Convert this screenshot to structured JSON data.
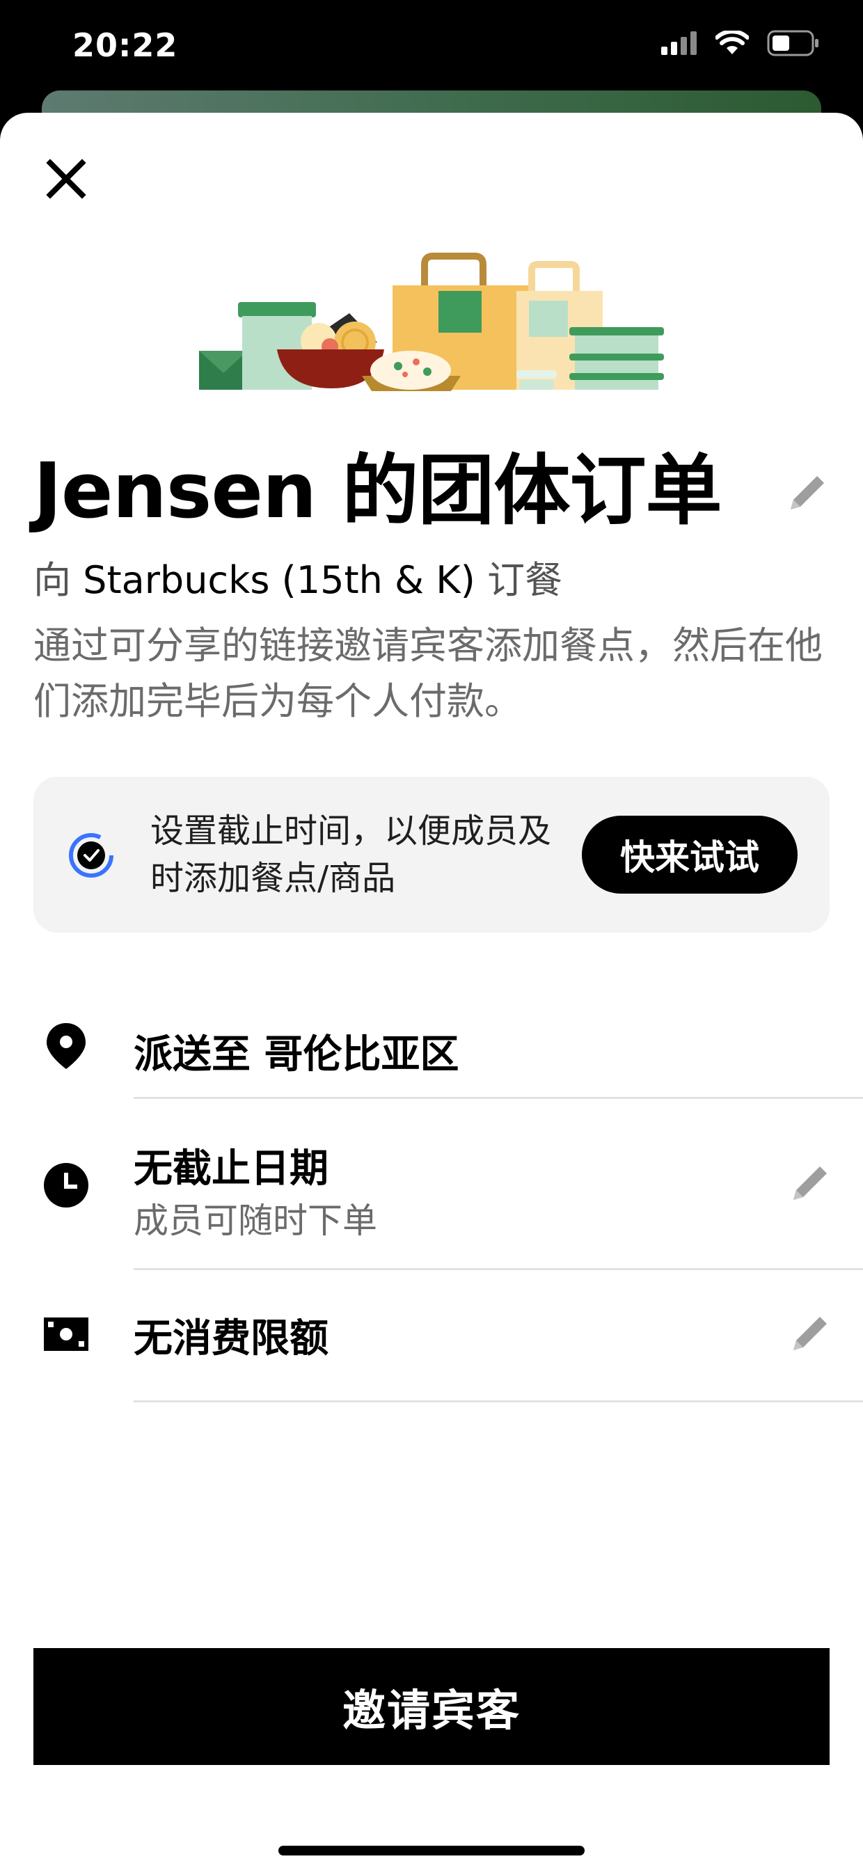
{
  "status_bar": {
    "time": "20:22",
    "icons": [
      "cellular-signal-icon",
      "wifi-icon",
      "battery-icon"
    ]
  },
  "sheet": {
    "close_icon": "close-icon",
    "illustration": "grocery-bags-and-food-illustration",
    "title": "Jensen 的团体订单",
    "subtitle": {
      "prefix": "向 ",
      "store": "Starbucks (15th & K)",
      "suffix": " 订餐"
    },
    "description": "通过可分享的链接邀请宾客添加餐点，然后在他们添加完毕后为每个人付款。",
    "promo": {
      "text": "设置截止时间，以便成员及时添加餐点/商品",
      "button_label": "快来试试"
    },
    "details": {
      "delivery": {
        "icon": "location-pin-icon",
        "title": "派送至 哥伦比亚区"
      },
      "deadline": {
        "icon": "clock-icon",
        "title": "无截止日期",
        "subtitle": "成员可随时下单"
      },
      "spending": {
        "icon": "cash-icon",
        "title": "无消费限额"
      }
    },
    "primary_button_label": "邀请宾客"
  },
  "colors": {
    "background": "#ffffff",
    "primary_button": "#000000",
    "promo_background": "#f3f3f3",
    "promo_icon_accent": "#3b73ff",
    "secondary_text": "#6b6b6b",
    "peek_card": "#3f6b4d"
  }
}
